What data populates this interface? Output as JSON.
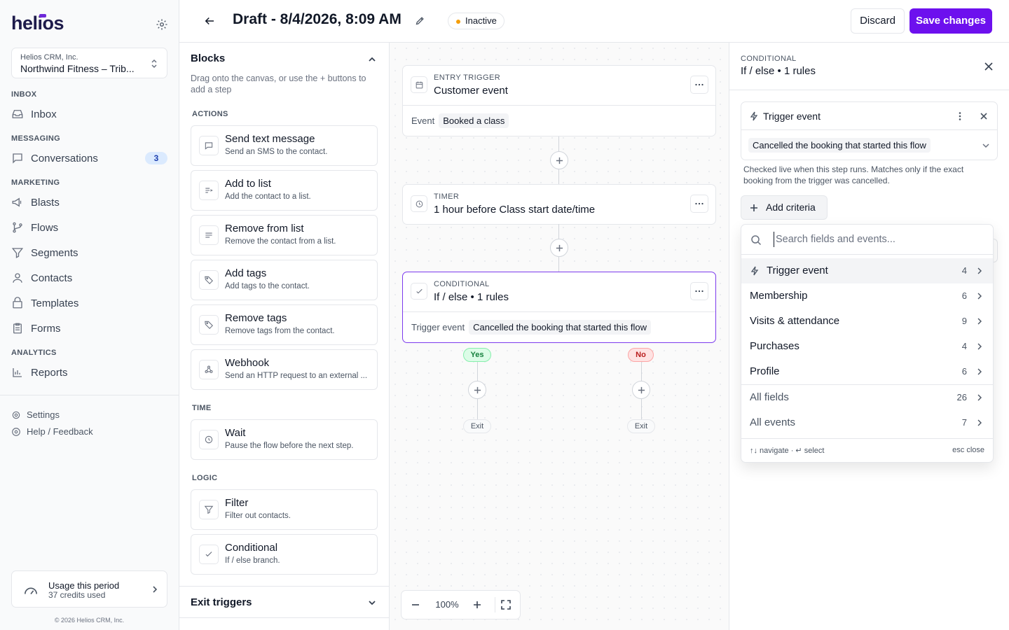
{
  "sidebar": {
    "logo": "helios",
    "account": {
      "org": "Helios CRM, Inc.",
      "name": "Northwind Fitness – Trib..."
    },
    "sections": [
      {
        "label": "INBOX",
        "items": [
          {
            "label": "Inbox",
            "icon": "inbox-icon"
          }
        ]
      },
      {
        "label": "MESSAGING",
        "items": [
          {
            "label": "Conversations",
            "icon": "chat-icon",
            "badge": "3"
          }
        ]
      },
      {
        "label": "MARKETING",
        "items": [
          {
            "label": "Blasts",
            "icon": "megaphone-icon"
          },
          {
            "label": "Flows",
            "icon": "flow-icon"
          },
          {
            "label": "Segments",
            "icon": "filter-icon"
          },
          {
            "label": "Contacts",
            "icon": "person-icon"
          },
          {
            "label": "Templates",
            "icon": "template-icon"
          },
          {
            "label": "Forms",
            "icon": "clipboard-icon"
          }
        ]
      },
      {
        "label": "ANALYTICS",
        "items": [
          {
            "label": "Reports",
            "icon": "bar-chart-icon"
          }
        ]
      }
    ],
    "settings": "Settings",
    "help": "Help / Feedback",
    "usage": {
      "title": "Usage this period",
      "sub": "37 credits used"
    },
    "copyright": "© 2026 Helios CRM, Inc."
  },
  "header": {
    "title": "Draft - 8/4/2026, 8:09 AM",
    "status": "Inactive",
    "status_color": "#f59e0b",
    "discard": "Discard",
    "save": "Save changes",
    "accent": "#6d10ee"
  },
  "blocks": {
    "title": "Blocks",
    "desc": "Drag onto the canvas, or use the + buttons to add a step",
    "actions_label": "ACTIONS",
    "actions": [
      {
        "title": "Send text message",
        "desc": "Send an SMS to the contact.",
        "icon": "message-icon"
      },
      {
        "title": "Add to list",
        "desc": "Add the contact to a list.",
        "icon": "list-add-icon"
      },
      {
        "title": "Remove from list",
        "desc": "Remove the contact from a list.",
        "icon": "list-remove-icon"
      },
      {
        "title": "Add tags",
        "desc": "Add tags to the contact.",
        "icon": "tag-icon"
      },
      {
        "title": "Remove tags",
        "desc": "Remove tags from the contact.",
        "icon": "tag-icon"
      },
      {
        "title": "Webhook",
        "desc": "Send an HTTP request to an external ...",
        "icon": "webhook-icon"
      }
    ],
    "time_label": "TIME",
    "time": [
      {
        "title": "Wait",
        "desc": "Pause the flow before the next step.",
        "icon": "clock-icon"
      }
    ],
    "logic_label": "LOGIC",
    "logic": [
      {
        "title": "Filter",
        "desc": "Filter out contacts.",
        "icon": "filter-icon"
      },
      {
        "title": "Conditional",
        "desc": "If / else branch.",
        "icon": "check-icon"
      }
    ],
    "exit_triggers": "Exit triggers"
  },
  "canvas": {
    "entry": {
      "label": "ENTRY TRIGGER",
      "title": "Customer event",
      "field": "Event",
      "value": "Booked a class"
    },
    "timer": {
      "label": "TIMER",
      "title": "1 hour before Class start date/time"
    },
    "conditional": {
      "label": "CONDITIONAL",
      "title": "If / else • 1 rules",
      "field": "Trigger event",
      "value": "Cancelled the booking that started this flow"
    },
    "yes": "Yes",
    "no": "No",
    "exit": "Exit",
    "zoom": "100%"
  },
  "panel": {
    "label": "CONDITIONAL",
    "title": "If / else • 1 rules",
    "criteria": {
      "title": "Trigger event",
      "value": "Cancelled the booking that started this flow"
    },
    "help": "Checked live when this step runs. Matches only if the exact booking from the trigger was cancelled.",
    "add_criteria": "Add criteria",
    "dropdown": {
      "placeholder": "Search fields and events...",
      "items": [
        {
          "label": "Trigger event",
          "count": "4"
        },
        {
          "label": "Membership",
          "count": "6"
        },
        {
          "label": "Visits & attendance",
          "count": "9"
        },
        {
          "label": "Purchases",
          "count": "4"
        },
        {
          "label": "Profile",
          "count": "6"
        }
      ],
      "all": [
        {
          "label": "All fields",
          "count": "26"
        },
        {
          "label": "All events",
          "count": "7"
        }
      ],
      "footer_left": "↑↓ navigate · ↵ select",
      "footer_right": "esc close"
    }
  }
}
